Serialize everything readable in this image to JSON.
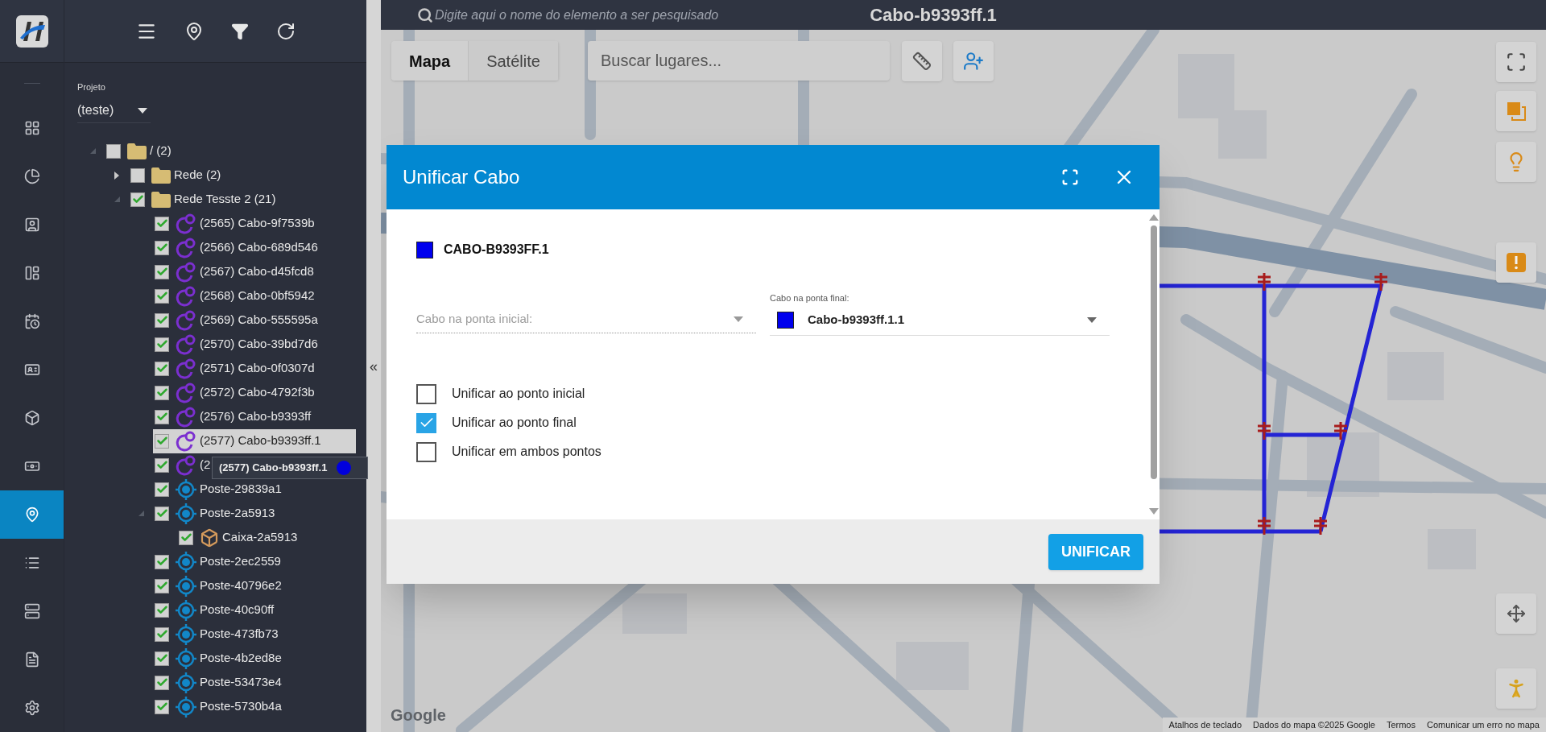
{
  "rail": {
    "items": [
      {
        "kind": "grid",
        "selected": false
      },
      {
        "kind": "chart",
        "selected": false
      },
      {
        "kind": "contact",
        "selected": false
      },
      {
        "kind": "board",
        "selected": false
      },
      {
        "kind": "calendar",
        "selected": false
      },
      {
        "kind": "badge",
        "selected": false
      },
      {
        "kind": "cube",
        "selected": false
      },
      {
        "kind": "money",
        "selected": false
      },
      {
        "kind": "pin",
        "selected": true
      },
      {
        "kind": "list",
        "selected": false
      },
      {
        "kind": "server",
        "selected": false
      },
      {
        "kind": "document",
        "selected": false
      },
      {
        "kind": "settings",
        "selected": false
      }
    ]
  },
  "project": {
    "label": "Projeto",
    "value": "(teste)"
  },
  "tree": [
    {
      "label": "/ (2)",
      "kind": "folder",
      "checked": false,
      "expanded": true,
      "selected": false,
      "children": [
        {
          "label": "Rede (2)",
          "kind": "folder",
          "checked": false,
          "expanded": false,
          "selected": false
        },
        {
          "label": "Rede Tesste 2 (21)",
          "kind": "folder",
          "checked": true,
          "expanded": true,
          "selected": false,
          "children": [
            {
              "label": "(2565) Cabo-9f7539b",
              "kind": "cable",
              "checked": true,
              "selected": false
            },
            {
              "label": "(2566) Cabo-689d546",
              "kind": "cable",
              "checked": true,
              "selected": false
            },
            {
              "label": "(2567) Cabo-d45fcd8",
              "kind": "cable",
              "checked": true,
              "selected": false
            },
            {
              "label": "(2568) Cabo-0bf5942",
              "kind": "cable",
              "checked": true,
              "selected": false
            },
            {
              "label": "(2569) Cabo-555595a",
              "kind": "cable",
              "checked": true,
              "selected": false
            },
            {
              "label": "(2570) Cabo-39bd7d6",
              "kind": "cable",
              "checked": true,
              "selected": false
            },
            {
              "label": "(2571) Cabo-0f0307d",
              "kind": "cable",
              "checked": true,
              "selected": false
            },
            {
              "label": "(2572) Cabo-4792f3b",
              "kind": "cable",
              "checked": true,
              "selected": false
            },
            {
              "label": "(2576) Cabo-b9393ff",
              "kind": "cable",
              "checked": true,
              "selected": false
            },
            {
              "label": "(2577) Cabo-b9393ff.1",
              "kind": "cable",
              "checked": true,
              "selected": true
            },
            {
              "label": "(2",
              "kind": "cable",
              "checked": true,
              "selected": false
            },
            {
              "label": "Poste-29839a1",
              "kind": "post",
              "checked": true,
              "selected": false
            },
            {
              "label": "Poste-2a5913",
              "kind": "post",
              "checked": true,
              "expanded": true,
              "selected": false,
              "children": [
                {
                  "label": "Caixa-2a5913",
                  "kind": "box",
                  "checked": true,
                  "selected": false
                }
              ]
            },
            {
              "label": "Poste-2ec2559",
              "kind": "post",
              "checked": true,
              "selected": false
            },
            {
              "label": "Poste-40796e2",
              "kind": "post",
              "checked": true,
              "selected": false
            },
            {
              "label": "Poste-40c90ff",
              "kind": "post",
              "checked": true,
              "selected": false
            },
            {
              "label": "Poste-473fb73",
              "kind": "post",
              "checked": true,
              "selected": false
            },
            {
              "label": "Poste-4b2ed8e",
              "kind": "post",
              "checked": true,
              "selected": false
            },
            {
              "label": "Poste-53473e4",
              "kind": "post",
              "checked": true,
              "selected": false
            },
            {
              "label": "Poste-5730b4a",
              "kind": "post",
              "checked": true,
              "selected": false
            }
          ]
        }
      ]
    }
  ],
  "tooltip": {
    "text": "(2577) Cabo-b9393ff.1"
  },
  "collapse_handle": "«",
  "search": {
    "placeholder": "Digite aqui o nome do elemento a ser pesquisado"
  },
  "title": "Cabo-b9393ff.1",
  "map_type_tabs": [
    {
      "label": "Mapa",
      "selected": true
    },
    {
      "label": "Satélite",
      "selected": false
    }
  ],
  "place_search": {
    "placeholder": "Buscar lugares..."
  },
  "dialog": {
    "title": "Unificar Cabo",
    "cable_name": "CABO-B9393FF.1",
    "start_field": {
      "placeholder": "Cabo na ponta inicial:"
    },
    "end_field": {
      "label": "Cabo na ponta final:",
      "value": "Cabo-b9393ff.1.1"
    },
    "options": [
      {
        "label": "Unificar ao ponto inicial",
        "checked": false
      },
      {
        "label": "Unificar ao ponto final",
        "checked": true
      },
      {
        "label": "Unificar em ambos pontos",
        "checked": false
      }
    ],
    "submit": "UNIFICAR"
  },
  "map_footer": {
    "logo": "Google",
    "links": [
      "Atalhos de teclado",
      "Dados do mapa ©2025 Google",
      "Termos",
      "Comunicar um erro no mapa"
    ]
  }
}
